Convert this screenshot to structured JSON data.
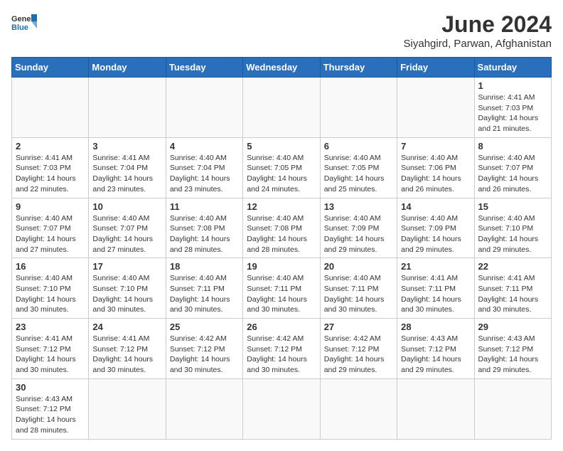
{
  "header": {
    "logo_general": "General",
    "logo_blue": "Blue",
    "month_title": "June 2024",
    "subtitle": "Siyahgird, Parwan, Afghanistan"
  },
  "weekdays": [
    "Sunday",
    "Monday",
    "Tuesday",
    "Wednesday",
    "Thursday",
    "Friday",
    "Saturday"
  ],
  "days": [
    {
      "date": "",
      "info": ""
    },
    {
      "date": "",
      "info": ""
    },
    {
      "date": "",
      "info": ""
    },
    {
      "date": "",
      "info": ""
    },
    {
      "date": "",
      "info": ""
    },
    {
      "date": "",
      "info": ""
    },
    {
      "date": "1",
      "info": "Sunrise: 4:41 AM\nSunset: 7:03 PM\nDaylight: 14 hours\nand 21 minutes."
    },
    {
      "date": "2",
      "info": "Sunrise: 4:41 AM\nSunset: 7:03 PM\nDaylight: 14 hours\nand 22 minutes."
    },
    {
      "date": "3",
      "info": "Sunrise: 4:41 AM\nSunset: 7:04 PM\nDaylight: 14 hours\nand 23 minutes."
    },
    {
      "date": "4",
      "info": "Sunrise: 4:40 AM\nSunset: 7:04 PM\nDaylight: 14 hours\nand 23 minutes."
    },
    {
      "date": "5",
      "info": "Sunrise: 4:40 AM\nSunset: 7:05 PM\nDaylight: 14 hours\nand 24 minutes."
    },
    {
      "date": "6",
      "info": "Sunrise: 4:40 AM\nSunset: 7:05 PM\nDaylight: 14 hours\nand 25 minutes."
    },
    {
      "date": "7",
      "info": "Sunrise: 4:40 AM\nSunset: 7:06 PM\nDaylight: 14 hours\nand 26 minutes."
    },
    {
      "date": "8",
      "info": "Sunrise: 4:40 AM\nSunset: 7:07 PM\nDaylight: 14 hours\nand 26 minutes."
    },
    {
      "date": "9",
      "info": "Sunrise: 4:40 AM\nSunset: 7:07 PM\nDaylight: 14 hours\nand 27 minutes."
    },
    {
      "date": "10",
      "info": "Sunrise: 4:40 AM\nSunset: 7:07 PM\nDaylight: 14 hours\nand 27 minutes."
    },
    {
      "date": "11",
      "info": "Sunrise: 4:40 AM\nSunset: 7:08 PM\nDaylight: 14 hours\nand 28 minutes."
    },
    {
      "date": "12",
      "info": "Sunrise: 4:40 AM\nSunset: 7:08 PM\nDaylight: 14 hours\nand 28 minutes."
    },
    {
      "date": "13",
      "info": "Sunrise: 4:40 AM\nSunset: 7:09 PM\nDaylight: 14 hours\nand 29 minutes."
    },
    {
      "date": "14",
      "info": "Sunrise: 4:40 AM\nSunset: 7:09 PM\nDaylight: 14 hours\nand 29 minutes."
    },
    {
      "date": "15",
      "info": "Sunrise: 4:40 AM\nSunset: 7:10 PM\nDaylight: 14 hours\nand 29 minutes."
    },
    {
      "date": "16",
      "info": "Sunrise: 4:40 AM\nSunset: 7:10 PM\nDaylight: 14 hours\nand 30 minutes."
    },
    {
      "date": "17",
      "info": "Sunrise: 4:40 AM\nSunset: 7:10 PM\nDaylight: 14 hours\nand 30 minutes."
    },
    {
      "date": "18",
      "info": "Sunrise: 4:40 AM\nSunset: 7:11 PM\nDaylight: 14 hours\nand 30 minutes."
    },
    {
      "date": "19",
      "info": "Sunrise: 4:40 AM\nSunset: 7:11 PM\nDaylight: 14 hours\nand 30 minutes."
    },
    {
      "date": "20",
      "info": "Sunrise: 4:40 AM\nSunset: 7:11 PM\nDaylight: 14 hours\nand 30 minutes."
    },
    {
      "date": "21",
      "info": "Sunrise: 4:41 AM\nSunset: 7:11 PM\nDaylight: 14 hours\nand 30 minutes."
    },
    {
      "date": "22",
      "info": "Sunrise: 4:41 AM\nSunset: 7:11 PM\nDaylight: 14 hours\nand 30 minutes."
    },
    {
      "date": "23",
      "info": "Sunrise: 4:41 AM\nSunset: 7:12 PM\nDaylight: 14 hours\nand 30 minutes."
    },
    {
      "date": "24",
      "info": "Sunrise: 4:41 AM\nSunset: 7:12 PM\nDaylight: 14 hours\nand 30 minutes."
    },
    {
      "date": "25",
      "info": "Sunrise: 4:42 AM\nSunset: 7:12 PM\nDaylight: 14 hours\nand 30 minutes."
    },
    {
      "date": "26",
      "info": "Sunrise: 4:42 AM\nSunset: 7:12 PM\nDaylight: 14 hours\nand 30 minutes."
    },
    {
      "date": "27",
      "info": "Sunrise: 4:42 AM\nSunset: 7:12 PM\nDaylight: 14 hours\nand 29 minutes."
    },
    {
      "date": "28",
      "info": "Sunrise: 4:43 AM\nSunset: 7:12 PM\nDaylight: 14 hours\nand 29 minutes."
    },
    {
      "date": "29",
      "info": "Sunrise: 4:43 AM\nSunset: 7:12 PM\nDaylight: 14 hours\nand 29 minutes."
    },
    {
      "date": "30",
      "info": "Sunrise: 4:43 AM\nSunset: 7:12 PM\nDaylight: 14 hours\nand 28 minutes."
    },
    {
      "date": "",
      "info": ""
    },
    {
      "date": "",
      "info": ""
    },
    {
      "date": "",
      "info": ""
    },
    {
      "date": "",
      "info": ""
    },
    {
      "date": "",
      "info": ""
    },
    {
      "date": "",
      "info": ""
    }
  ]
}
